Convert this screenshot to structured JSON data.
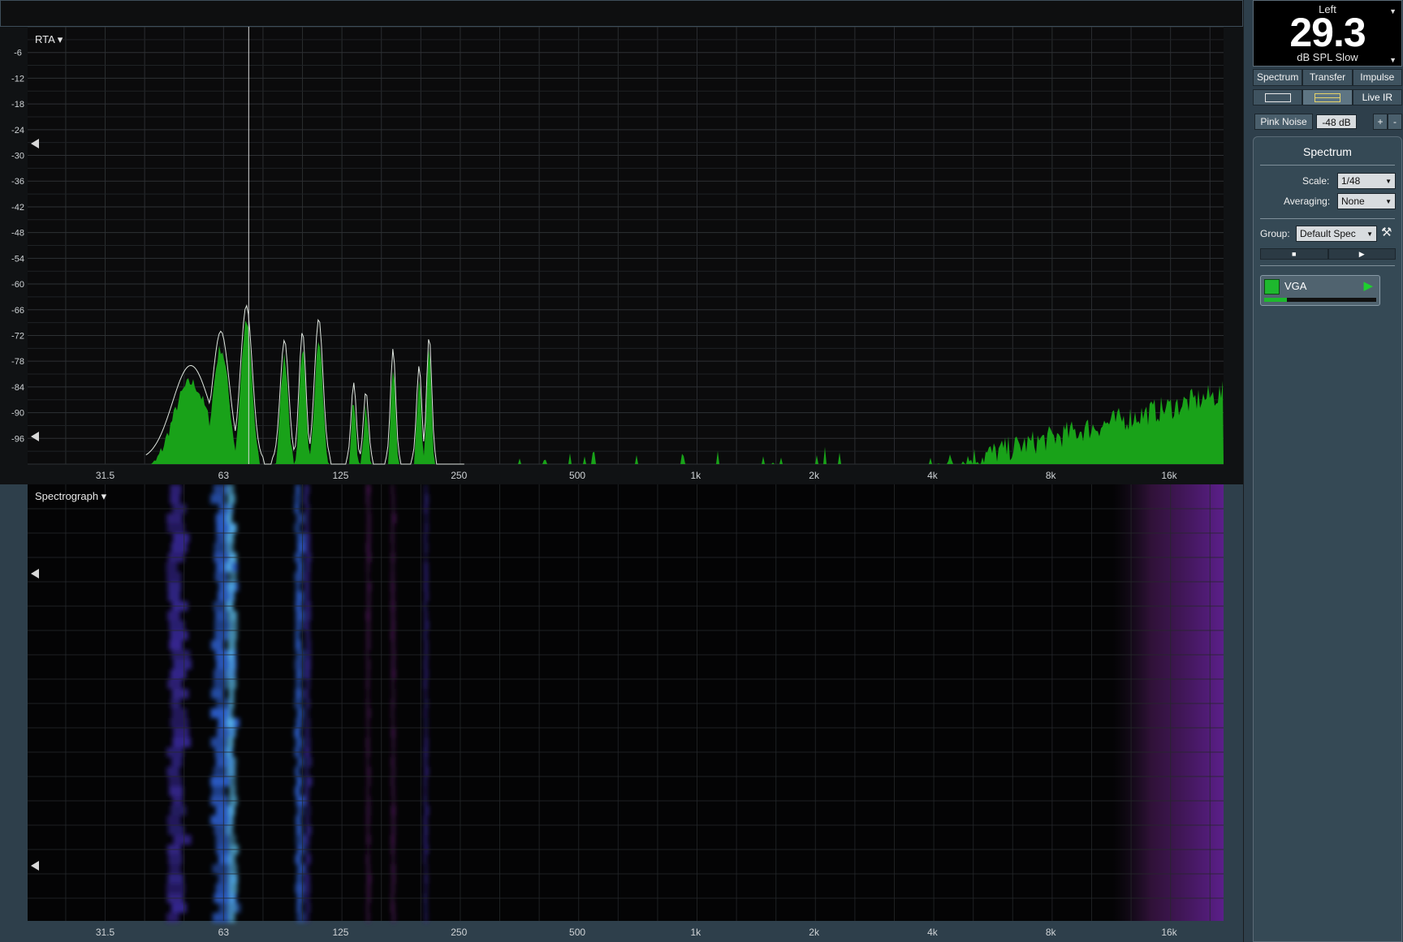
{
  "rta": {
    "label": "RTA ▾",
    "y_ticks": [
      "-6",
      "-12",
      "-18",
      "-24",
      "-30",
      "-36",
      "-42",
      "-48",
      "-54",
      "-60",
      "-66",
      "-72",
      "-78",
      "-84",
      "-90",
      "-96"
    ],
    "x_ticks": [
      "31.5",
      "63",
      "125",
      "250",
      "500",
      "1k",
      "2k",
      "4k",
      "8k",
      "16k"
    ],
    "spectrum_color": "#19a219",
    "trace_color": "#dfe6df",
    "cursor_hz": 73
  },
  "spectrograph": {
    "label": "Spectrograph ▾",
    "x_ticks": [
      "31.5",
      "63",
      "125",
      "250",
      "500",
      "1k",
      "2k",
      "4k",
      "8k",
      "16k"
    ],
    "colors": [
      "#3a2a9e",
      "#2f63d6",
      "#5cc0f0",
      "#5b1f6a"
    ]
  },
  "meter": {
    "channel": "Left",
    "value": "29.3",
    "unit": "dB SPL Slow"
  },
  "tabs": [
    "Spectrum",
    "Transfer",
    "Impulse"
  ],
  "views": {
    "live_ir": "Live IR"
  },
  "generator": {
    "button": "Pink Noise",
    "level": "-48 dB",
    "plus": "+",
    "minus": "-"
  },
  "spectrum_panel": {
    "title": "Spectrum",
    "scale_label": "Scale:",
    "scale_value": "1/48",
    "averaging_label": "Averaging:",
    "averaging_value": "None",
    "group_label": "Group:",
    "group_value": "Default Spec",
    "stop_glyph": "■",
    "play_glyph": "▶",
    "tool_glyph": "⚒"
  },
  "measurement": {
    "name": "VGA",
    "color": "#1eb82e",
    "play_glyph": "▶",
    "level_fraction": 0.2
  }
}
